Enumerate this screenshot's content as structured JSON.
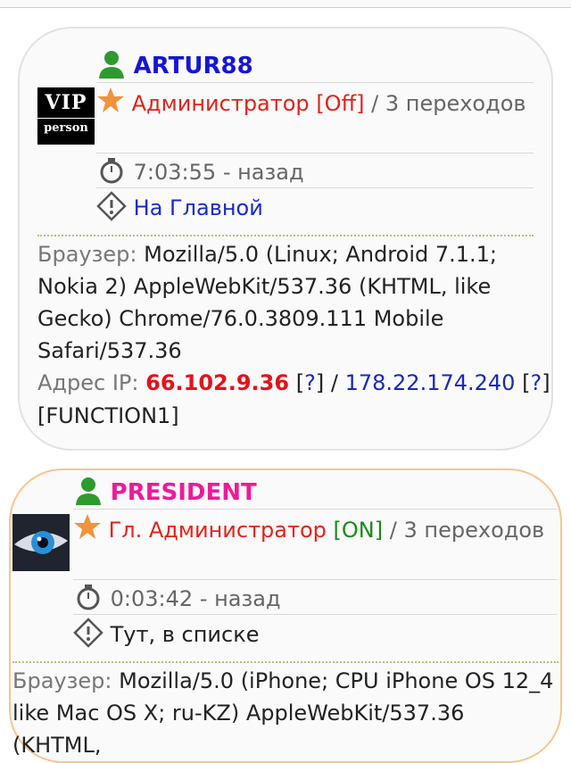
{
  "users": [
    {
      "nick": "ARTUR88",
      "avatar_text_top": "VIP",
      "avatar_text_bottom": "person",
      "role": "Администратор",
      "status": "[Off]",
      "clicks_sep": "/",
      "clicks_count": "3",
      "clicks_word": "переходов",
      "time": "7:03:55",
      "time_suffix": "- назад",
      "location": "На Главной",
      "browser_label": "Браузер:",
      "browser": "Mozilla/5.0 (Linux; Android 7.1.1; Nokia 2) AppleWebKit/537.36 (KHTML, like Gecko) Chrome/76.0.3809.111 Mobile Safari/537.36",
      "ip_label": "Адрес IP:",
      "ip": "66.102.9.36",
      "ip_query": "?",
      "ip2": "178.22.174.240",
      "ip2_query": "?",
      "extra": "[FUNCTION1]"
    },
    {
      "nick": "PRESIDENT",
      "role": "Гл. Администратор",
      "status": "[ON]",
      "clicks_sep": "/",
      "clicks_count": "3",
      "clicks_word": "переходов",
      "time": "0:03:42",
      "time_suffix": "- назад",
      "location": "Тут, в списке",
      "browser_label": "Браузер:",
      "browser": "Mozilla/5.0 (iPhone; CPU iPhone OS 12_4 like Mac OS X; ru-KZ) AppleWebKit/537.36 (KHTML,"
    }
  ],
  "icons": [
    "user-icon",
    "star-icon",
    "stopwatch-icon",
    "warning-diamond-icon"
  ],
  "colors": {
    "nick1": "#1515d8",
    "nick2": "#ee1a9a",
    "role": "#e2231a",
    "on": "#1a8a1a",
    "card2_border": "#f6c58e"
  }
}
